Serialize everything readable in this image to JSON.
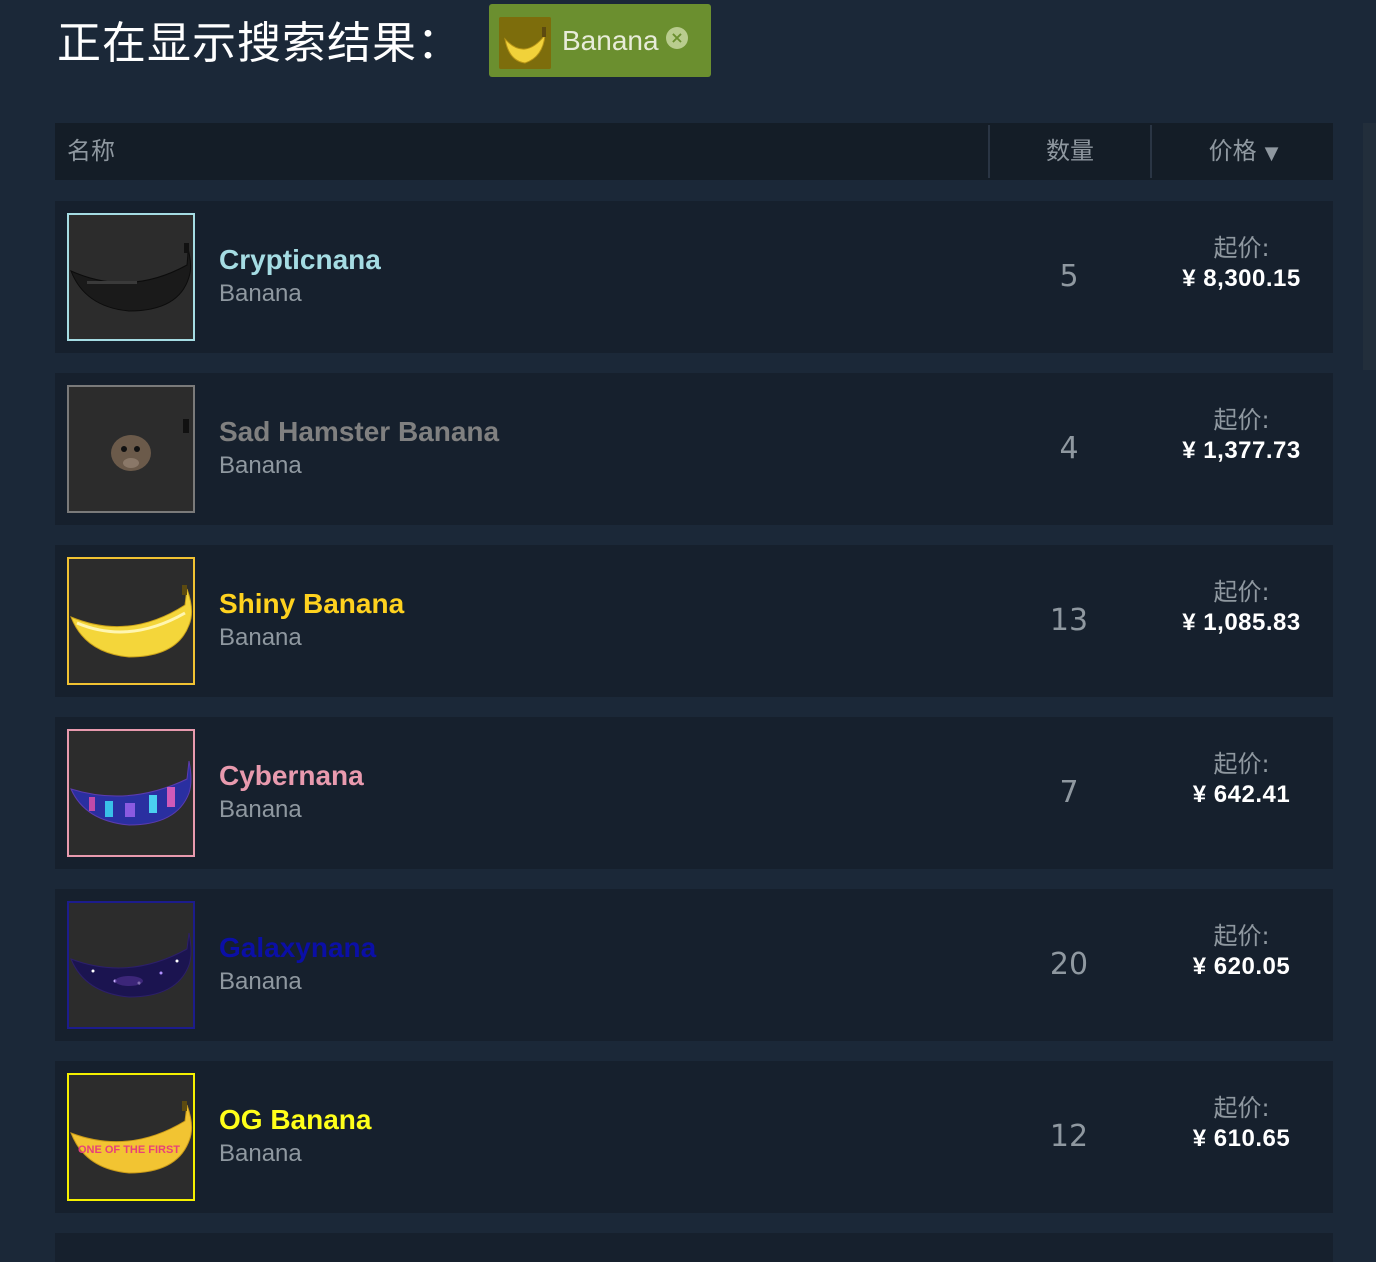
{
  "header": {
    "title": "正在显示搜索结果：",
    "filter_tag": {
      "label": "Banana",
      "icon": "banana-icon",
      "close_icon": "close-circle-icon",
      "color": "#6b8f2f"
    }
  },
  "table": {
    "columns": {
      "name": "名称",
      "quantity": "数量",
      "price": "价格",
      "price_sort_icon": "▼"
    },
    "price_prefix": "起价:",
    "rows": [
      {
        "name": "Crypticnana",
        "game": "Banana",
        "quantity": "5",
        "price_label": "起价:",
        "price": "¥ 8,300.15",
        "name_color": "#a5dce3",
        "border_color": "#a5dce3",
        "icon": "black-banana-icon"
      },
      {
        "name": "Sad Hamster Banana",
        "game": "Banana",
        "quantity": "4",
        "price_label": "起价:",
        "price": "¥ 1,377.73",
        "name_color": "#808080",
        "border_color": "#7a7a7a",
        "icon": "hamster-banana-icon"
      },
      {
        "name": "Shiny Banana",
        "game": "Banana",
        "quantity": "13",
        "price_label": "起价:",
        "price": "¥ 1,085.83",
        "name_color": "#ffd21f",
        "border_color": "#f1c232",
        "icon": "yellow-banana-icon"
      },
      {
        "name": "Cybernana",
        "game": "Banana",
        "quantity": "7",
        "price_label": "起价:",
        "price": "¥ 642.41",
        "name_color": "#e89aae",
        "border_color": "#e89aae",
        "icon": "cyber-banana-icon"
      },
      {
        "name": "Galaxynana",
        "game": "Banana",
        "quantity": "20",
        "price_label": "起价:",
        "price": "¥ 620.05",
        "name_color": "#0b0fa6",
        "border_color": "#1c1c8c",
        "icon": "galaxy-banana-icon"
      },
      {
        "name": "OG Banana",
        "game": "Banana",
        "quantity": "12",
        "price_label": "起价:",
        "price": "¥ 610.65",
        "name_color": "#ffff1a",
        "border_color": "#f5f000",
        "icon": "og-banana-icon",
        "thumb_text": "ONE OF THE FIRST"
      }
    ]
  }
}
